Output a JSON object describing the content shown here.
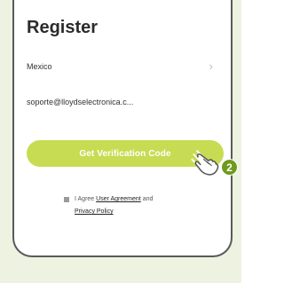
{
  "register": {
    "title": "Register",
    "country_value": "Mexico",
    "email_value": "soporte@lloydselectronica.c...",
    "get_code_label": "Get Verification Code",
    "agree_prefix": "I Agree",
    "user_agreement": "User Agreement",
    "and_text": "and",
    "privacy_policy": "Privacy Policy"
  },
  "annotation": {
    "step_number": "2"
  },
  "icons": [
    "chevron-right-icon",
    "pointing-hand-icon",
    "step-badge"
  ],
  "colors": {
    "accent": "#c7dc52",
    "badge": "#6e9a1e",
    "panel_background": "#eef2e1"
  }
}
